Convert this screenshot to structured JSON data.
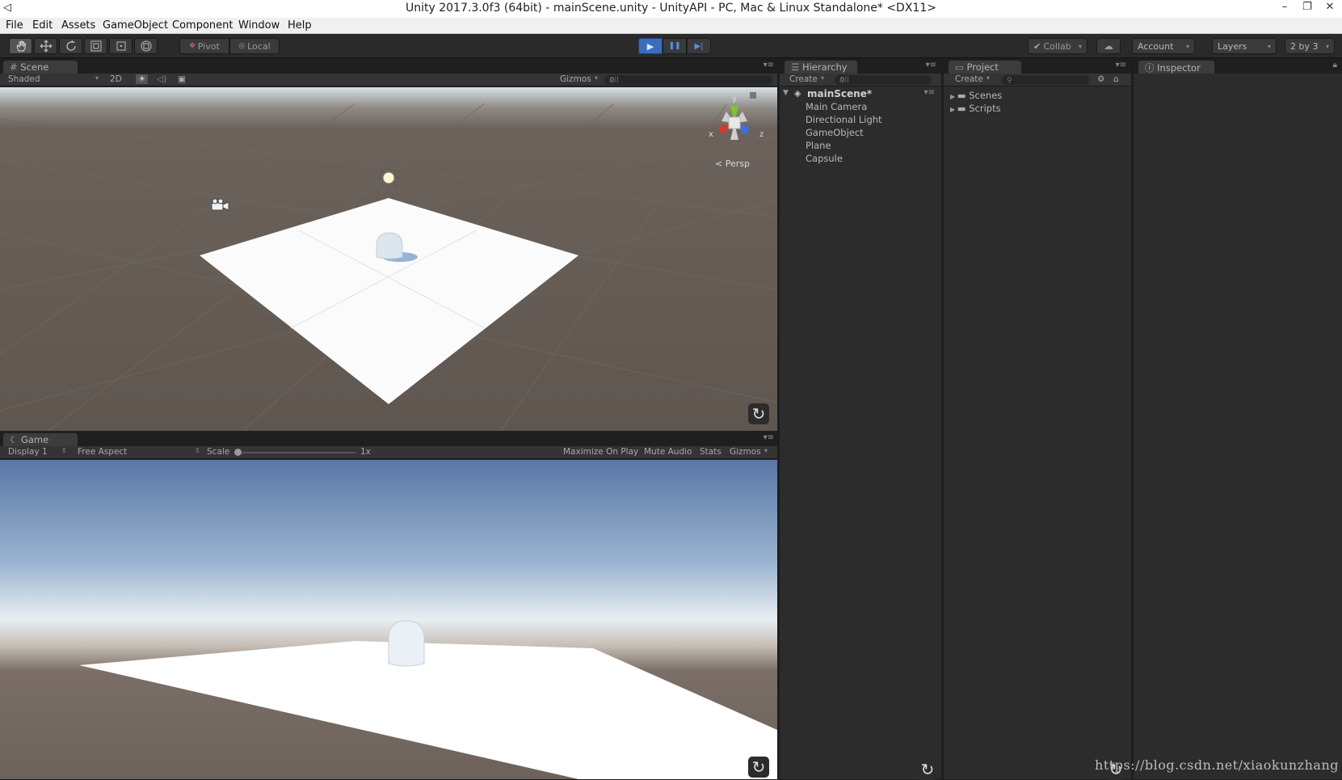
{
  "window": {
    "title": "Unity 2017.3.0f3 (64bit) - mainScene.unity - UnityAPI - PC, Mac & Linux Standalone* <DX11>",
    "controls": [
      "–",
      "❐",
      "✕"
    ]
  },
  "menu": [
    "File",
    "Edit",
    "Assets",
    "GameObject",
    "Component",
    "Window",
    "Help"
  ],
  "toolbar": {
    "tools": [
      "hand-icon",
      "move-icon",
      "rotate-icon",
      "scale-icon",
      "rect-icon",
      "transform-icon"
    ],
    "pivot_label": "Pivot",
    "local_label": "Local",
    "play_icon": "▶",
    "pause_icon": "❚❚",
    "step_icon": "▶|",
    "collab_label": "Collab",
    "account_label": "Account",
    "layers_label": "Layers",
    "layout_label": "2 by 3",
    "accent_color": "#3b6db8"
  },
  "scene": {
    "tab_label": "Scene",
    "shading_mode": "Shaded",
    "mode_2d": "2D",
    "gizmos_label": "Gizmos",
    "search_placeholder": "All",
    "persp_label": "Persp",
    "axes": {
      "x": "x",
      "y": "y",
      "z": "z"
    }
  },
  "game": {
    "tab_label": "Game",
    "display": "Display 1",
    "aspect": "Free Aspect",
    "scale_label": "Scale",
    "scale_value": "1x",
    "toggles": [
      "Maximize On Play",
      "Mute Audio",
      "Stats",
      "Gizmos"
    ]
  },
  "hierarchy": {
    "tab_label": "Hierarchy",
    "create_label": "Create",
    "search_placeholder": "All",
    "scene_name": "mainScene*",
    "items": [
      "Main Camera",
      "Directional Light",
      "GameObject",
      "Plane",
      "Capsule"
    ]
  },
  "project": {
    "tab_label": "Project",
    "create_label": "Create",
    "folders": [
      "Scenes",
      "Scripts"
    ]
  },
  "inspector": {
    "tab_label": "Inspector"
  },
  "watermark": "https://blog.csdn.net/xiaokunzhang"
}
